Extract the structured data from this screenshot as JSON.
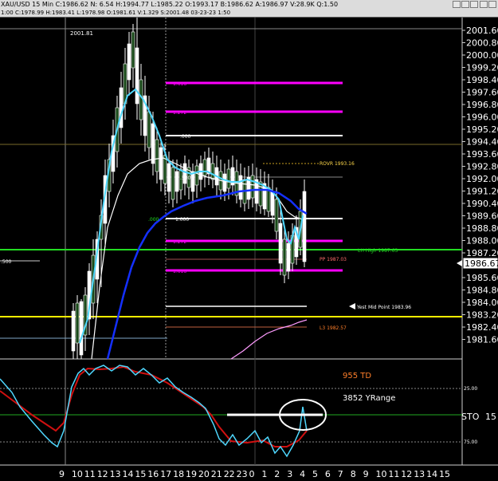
{
  "window": {
    "title": "XAU/USD 15 Min C:1986.62 N: 6.54 H:1994.77 L:1985.22 O:1993.17 B:1986.62 A:1986.97 V:28.9K Q:1.50",
    "subtitle": "1:00 C:1978.99 H:1983.41 L:1978.98 O:1981.61 V:1.329 S:2001.48 03-23-23 1:50"
  },
  "price_axis": {
    "ticks": [
      "2001.60",
      "2000.80",
      "2000.00",
      "1999.20",
      "1998.40",
      "1997.60",
      "1996.80",
      "1996.00",
      "1995.20",
      "1994.40",
      "1993.60",
      "1992.80",
      "1992.00",
      "1991.20",
      "1990.40",
      "1989.60",
      "1988.80",
      "1988.00",
      "1987.20",
      "1986.40",
      "1985.60",
      "1984.80",
      "1984.00",
      "1983.20",
      "1982.40",
      "1981.60"
    ],
    "current_price": "1986.67"
  },
  "time_axis": {
    "labels": [
      "9",
      "10",
      "11",
      "12",
      "13",
      "14",
      "15",
      "16",
      "17",
      "18",
      "19",
      "20",
      "21",
      "22",
      "23",
      "0",
      "1",
      "2",
      "3",
      "4",
      "5",
      "6",
      "7",
      "8",
      "9",
      "10",
      "11",
      "12",
      "13",
      "14",
      "15"
    ]
  },
  "annotations": {
    "session_high": "2001.81",
    "fib_1618_top": "1.618",
    "fib_1272_top": "1.272",
    "fib_000": ".000",
    "fib_500": ".500",
    "fib_1000": "1.000",
    "fib_000_low": ".000",
    "fib_1272_bottom": "1.272",
    "fib_1618_bottom": "1.618",
    "rovr": "ROVR 1993.16",
    "lh_high": "LH High 1987.63",
    "pp": "PP 1987.03",
    "left_500": ".500",
    "yest_mid": "Yest Mid Point 1983.96",
    "l3": "L3 1982.57"
  },
  "oscillator": {
    "label": "STO",
    "period": "15",
    "level_25": "25.00",
    "level_75": "75.00",
    "td_text": "955 TD",
    "yrange_text": "3852 YRange"
  },
  "colors": {
    "magenta": "#ff00ff",
    "white": "#ffffff",
    "cyan": "#4fd8ff",
    "blue": "#1430ff",
    "green": "#22dd22",
    "yellow": "#ffee00",
    "pink": "#ff9cff",
    "orange_text": "#ff7f2a",
    "stoch_red": "#d01010"
  }
}
